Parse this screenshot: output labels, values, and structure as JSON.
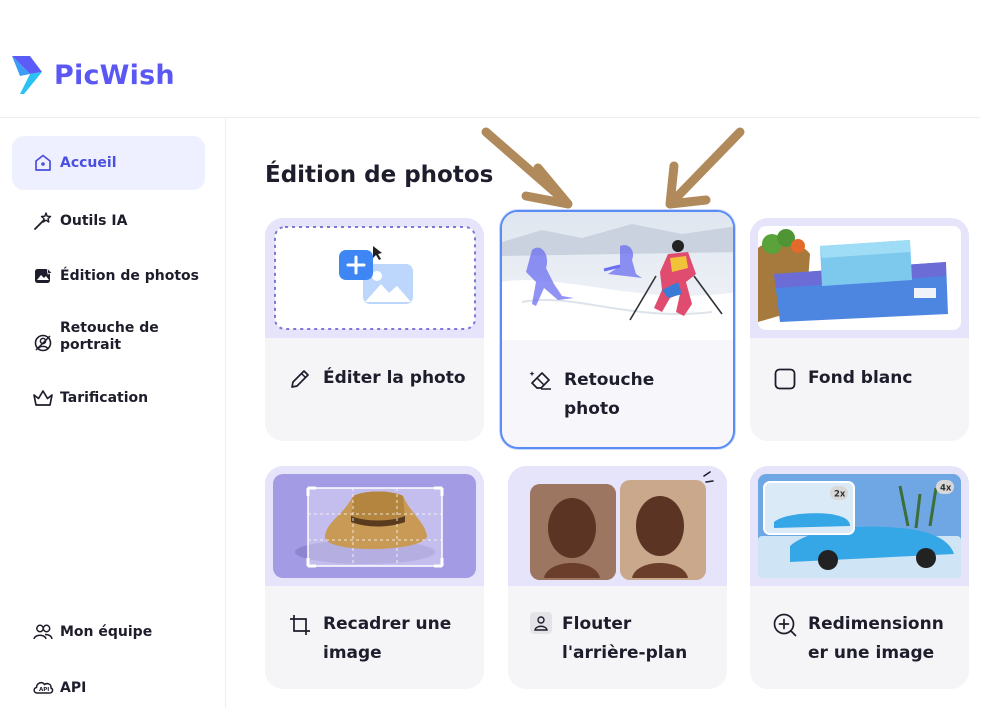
{
  "brand": {
    "name": "PicWish"
  },
  "sidebar": {
    "items": [
      {
        "label": "Accueil",
        "icon": "home-icon",
        "active": true
      },
      {
        "label": "Outils IA",
        "icon": "magic-wand-icon"
      },
      {
        "label": "Édition de photos",
        "icon": "photo-edit-icon"
      },
      {
        "label": "Retouche de portrait",
        "icon": "portrait-icon"
      },
      {
        "label": "Tarification",
        "icon": "crown-icon"
      }
    ],
    "bottom_items": [
      {
        "label": "Mon équipe",
        "icon": "team-icon"
      },
      {
        "label": "API",
        "icon": "api-icon"
      }
    ]
  },
  "main": {
    "title": "Édition de photos",
    "cards": [
      {
        "label": "Éditer la photo",
        "icon": "pencil-icon"
      },
      {
        "label": "Retouche photo",
        "icon": "eraser-icon",
        "highlighted": true
      },
      {
        "label": "Fond blanc",
        "icon": "square-icon"
      },
      {
        "label": "Recadrer une image",
        "icon": "crop-icon"
      },
      {
        "label": "Flouter l'arrière-plan",
        "icon": "blur-icon"
      },
      {
        "label": "Redimensionner une image",
        "icon": "zoom-in-icon"
      }
    ],
    "badges": {
      "zoom_2x": "2x",
      "zoom_4x": "4x"
    }
  },
  "colors": {
    "brand": "#5b57f5",
    "active_bg": "#eef0ff",
    "arrow": "#b08a5a",
    "highlight_border": "#5b8cf5"
  }
}
